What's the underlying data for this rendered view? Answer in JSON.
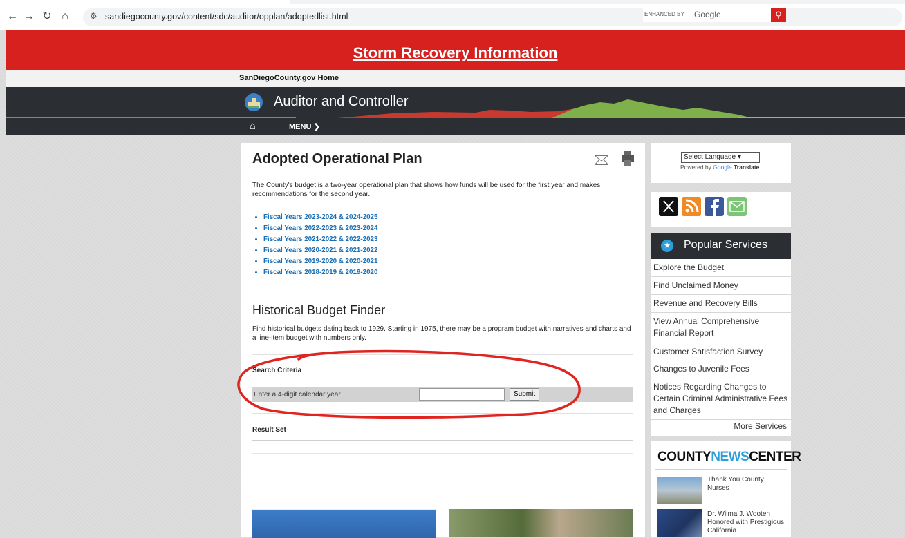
{
  "browser": {
    "url": "sandiegocounty.gov/content/sdc/auditor/opplan/adoptedlist.html"
  },
  "banner": {
    "text": "Storm Recovery Information"
  },
  "topbar": {
    "home_link_site": "SanDiegoCounty.gov",
    "home_link_home": "Home"
  },
  "header": {
    "dept_title": "Auditor and Controller",
    "search_label": "ENHANCED BY",
    "search_brand": "Google"
  },
  "nav": {
    "menu_label": "MENU ❯"
  },
  "main": {
    "title": "Adopted Operational Plan",
    "intro": "The County's budget is a two-year operational plan that shows how funds will be used for the first year and makes recommendations for the second year.",
    "fiscal_links": [
      "Fiscal Years 2023-2024 & 2024-2025",
      "Fiscal Years 2022-2023 & 2023-2024",
      "Fiscal Years 2021-2022 & 2022-2023",
      "Fiscal Years 2020-2021 & 2021-2022",
      "Fiscal Years 2019-2020 & 2020-2021",
      "Fiscal Years 2018-2019 & 2019-2020"
    ],
    "finder_title": "Historical Budget Finder",
    "finder_desc": "Find historical budgets dating back to 1929. Starting in 1975, there may be a program budget with narratives and charts and a line-item budget with numbers only.",
    "search_criteria_title": "Search Criteria",
    "year_label": "Enter a 4-digit calendar year",
    "year_value": "",
    "submit_label": "Submit",
    "result_set_title": "Result Set"
  },
  "sidebar": {
    "language_select": "Select Language",
    "powered_by": "Powered by",
    "google": "Google",
    "translate": "Translate",
    "social_icons": [
      "x-icon",
      "rss-icon",
      "facebook-icon",
      "email-icon"
    ],
    "popular_title": "Popular Services",
    "popular_items": [
      "Explore the Budget",
      "Find Unclaimed Money",
      "Revenue and Recovery Bills",
      "View Annual Comprehensive Financial Report",
      "Customer Satisfaction Survey",
      "Changes to Juvenile Fees",
      "Notices Regarding Changes to Certain Criminal Administrative Fees and Charges"
    ],
    "more_services": "More Services",
    "news_title_1": "COUNTY",
    "news_title_2": "NEWS",
    "news_title_3": "CENTER",
    "news_items": [
      "Thank You County Nurses",
      "Dr. Wilma J. Wooten Honored with Prestigious California"
    ]
  },
  "colors": {
    "banner_red": "#d6211e",
    "header_dark": "#2b2f33",
    "link_blue": "#1a6fb5",
    "accent_blue": "#2c9fd9"
  }
}
